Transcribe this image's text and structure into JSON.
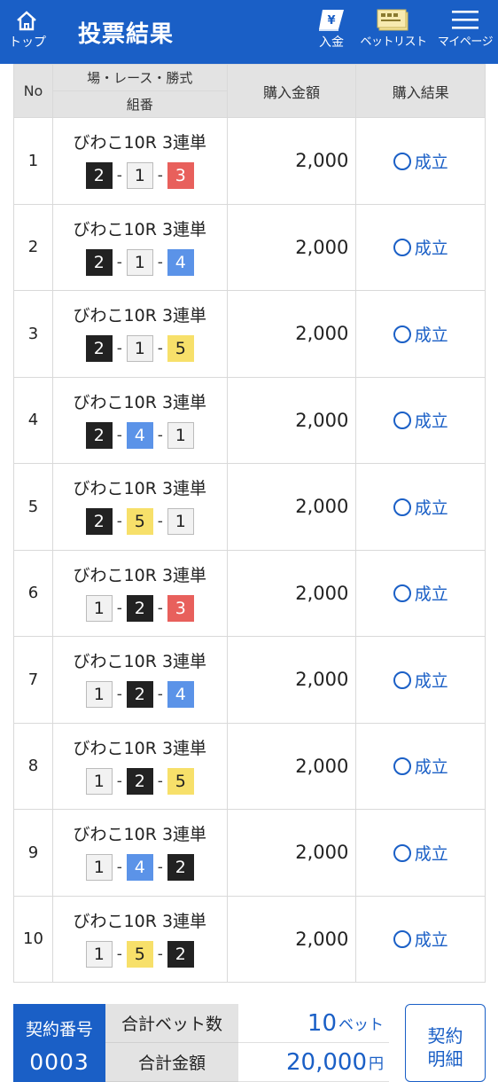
{
  "header": {
    "home_label": "トップ",
    "title": "投票結果",
    "deposit_label": "入金",
    "betlist_label": "ベットリスト",
    "mypage_label": "マイページ"
  },
  "table": {
    "col_no": "No",
    "col_venue": "場・レース・勝式",
    "col_combo": "組番",
    "col_amount": "購入金額",
    "col_result": "購入結果",
    "rows": [
      {
        "no": "1",
        "race": "びわこ10R 3連単",
        "c1": "2",
        "c2": "1",
        "c3": "3",
        "amount": "2,000",
        "result": "成立"
      },
      {
        "no": "2",
        "race": "びわこ10R 3連単",
        "c1": "2",
        "c2": "1",
        "c3": "4",
        "amount": "2,000",
        "result": "成立"
      },
      {
        "no": "3",
        "race": "びわこ10R 3連単",
        "c1": "2",
        "c2": "1",
        "c3": "5",
        "amount": "2,000",
        "result": "成立"
      },
      {
        "no": "4",
        "race": "びわこ10R 3連単",
        "c1": "2",
        "c2": "4",
        "c3": "1",
        "amount": "2,000",
        "result": "成立"
      },
      {
        "no": "5",
        "race": "びわこ10R 3連単",
        "c1": "2",
        "c2": "5",
        "c3": "1",
        "amount": "2,000",
        "result": "成立"
      },
      {
        "no": "6",
        "race": "びわこ10R 3連単",
        "c1": "1",
        "c2": "2",
        "c3": "3",
        "amount": "2,000",
        "result": "成立"
      },
      {
        "no": "7",
        "race": "びわこ10R 3連単",
        "c1": "1",
        "c2": "2",
        "c3": "4",
        "amount": "2,000",
        "result": "成立"
      },
      {
        "no": "8",
        "race": "びわこ10R 3連単",
        "c1": "1",
        "c2": "2",
        "c3": "5",
        "amount": "2,000",
        "result": "成立"
      },
      {
        "no": "9",
        "race": "びわこ10R 3連単",
        "c1": "1",
        "c2": "4",
        "c3": "2",
        "amount": "2,000",
        "result": "成立"
      },
      {
        "no": "10",
        "race": "びわこ10R 3連単",
        "c1": "1",
        "c2": "5",
        "c3": "2",
        "amount": "2,000",
        "result": "成立"
      }
    ]
  },
  "boat_colors": {
    "1": {
      "bg": "#f2f2f2",
      "fg": "#222222"
    },
    "2": {
      "bg": "#222222",
      "fg": "#ffffff"
    },
    "3": {
      "bg": "#e8605c",
      "fg": "#ffffff"
    },
    "4": {
      "bg": "#5b93e8",
      "fg": "#ffffff"
    },
    "5": {
      "bg": "#f7e06a",
      "fg": "#222222"
    }
  },
  "footer": {
    "contract_label": "契約番号",
    "contract_no": "0003",
    "bets_label": "合計ベット数",
    "bets_value": "10",
    "bets_unit": "ベット",
    "total_label": "合計金額",
    "total_value": "20,000",
    "total_unit": "円",
    "detail_button_line1": "契約",
    "detail_button_line2": "明細"
  },
  "colors": {
    "accent": "#1a5fc6",
    "header_cell": "#e3e3e3"
  }
}
